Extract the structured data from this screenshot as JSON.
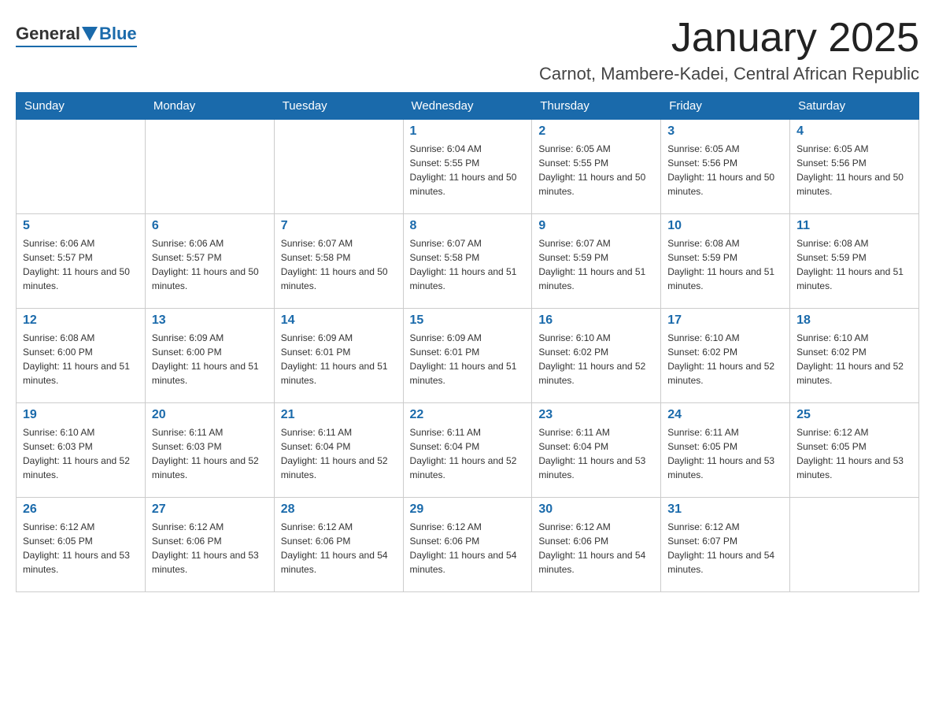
{
  "header": {
    "logo_general": "General",
    "logo_blue": "Blue",
    "title": "January 2025",
    "subtitle": "Carnot, Mambere-Kadei, Central African Republic"
  },
  "days_of_week": [
    "Sunday",
    "Monday",
    "Tuesday",
    "Wednesday",
    "Thursday",
    "Friday",
    "Saturday"
  ],
  "weeks": [
    [
      {
        "day": "",
        "info": ""
      },
      {
        "day": "",
        "info": ""
      },
      {
        "day": "",
        "info": ""
      },
      {
        "day": "1",
        "info": "Sunrise: 6:04 AM\nSunset: 5:55 PM\nDaylight: 11 hours and 50 minutes."
      },
      {
        "day": "2",
        "info": "Sunrise: 6:05 AM\nSunset: 5:55 PM\nDaylight: 11 hours and 50 minutes."
      },
      {
        "day": "3",
        "info": "Sunrise: 6:05 AM\nSunset: 5:56 PM\nDaylight: 11 hours and 50 minutes."
      },
      {
        "day": "4",
        "info": "Sunrise: 6:05 AM\nSunset: 5:56 PM\nDaylight: 11 hours and 50 minutes."
      }
    ],
    [
      {
        "day": "5",
        "info": "Sunrise: 6:06 AM\nSunset: 5:57 PM\nDaylight: 11 hours and 50 minutes."
      },
      {
        "day": "6",
        "info": "Sunrise: 6:06 AM\nSunset: 5:57 PM\nDaylight: 11 hours and 50 minutes."
      },
      {
        "day": "7",
        "info": "Sunrise: 6:07 AM\nSunset: 5:58 PM\nDaylight: 11 hours and 50 minutes."
      },
      {
        "day": "8",
        "info": "Sunrise: 6:07 AM\nSunset: 5:58 PM\nDaylight: 11 hours and 51 minutes."
      },
      {
        "day": "9",
        "info": "Sunrise: 6:07 AM\nSunset: 5:59 PM\nDaylight: 11 hours and 51 minutes."
      },
      {
        "day": "10",
        "info": "Sunrise: 6:08 AM\nSunset: 5:59 PM\nDaylight: 11 hours and 51 minutes."
      },
      {
        "day": "11",
        "info": "Sunrise: 6:08 AM\nSunset: 5:59 PM\nDaylight: 11 hours and 51 minutes."
      }
    ],
    [
      {
        "day": "12",
        "info": "Sunrise: 6:08 AM\nSunset: 6:00 PM\nDaylight: 11 hours and 51 minutes."
      },
      {
        "day": "13",
        "info": "Sunrise: 6:09 AM\nSunset: 6:00 PM\nDaylight: 11 hours and 51 minutes."
      },
      {
        "day": "14",
        "info": "Sunrise: 6:09 AM\nSunset: 6:01 PM\nDaylight: 11 hours and 51 minutes."
      },
      {
        "day": "15",
        "info": "Sunrise: 6:09 AM\nSunset: 6:01 PM\nDaylight: 11 hours and 51 minutes."
      },
      {
        "day": "16",
        "info": "Sunrise: 6:10 AM\nSunset: 6:02 PM\nDaylight: 11 hours and 52 minutes."
      },
      {
        "day": "17",
        "info": "Sunrise: 6:10 AM\nSunset: 6:02 PM\nDaylight: 11 hours and 52 minutes."
      },
      {
        "day": "18",
        "info": "Sunrise: 6:10 AM\nSunset: 6:02 PM\nDaylight: 11 hours and 52 minutes."
      }
    ],
    [
      {
        "day": "19",
        "info": "Sunrise: 6:10 AM\nSunset: 6:03 PM\nDaylight: 11 hours and 52 minutes."
      },
      {
        "day": "20",
        "info": "Sunrise: 6:11 AM\nSunset: 6:03 PM\nDaylight: 11 hours and 52 minutes."
      },
      {
        "day": "21",
        "info": "Sunrise: 6:11 AM\nSunset: 6:04 PM\nDaylight: 11 hours and 52 minutes."
      },
      {
        "day": "22",
        "info": "Sunrise: 6:11 AM\nSunset: 6:04 PM\nDaylight: 11 hours and 52 minutes."
      },
      {
        "day": "23",
        "info": "Sunrise: 6:11 AM\nSunset: 6:04 PM\nDaylight: 11 hours and 53 minutes."
      },
      {
        "day": "24",
        "info": "Sunrise: 6:11 AM\nSunset: 6:05 PM\nDaylight: 11 hours and 53 minutes."
      },
      {
        "day": "25",
        "info": "Sunrise: 6:12 AM\nSunset: 6:05 PM\nDaylight: 11 hours and 53 minutes."
      }
    ],
    [
      {
        "day": "26",
        "info": "Sunrise: 6:12 AM\nSunset: 6:05 PM\nDaylight: 11 hours and 53 minutes."
      },
      {
        "day": "27",
        "info": "Sunrise: 6:12 AM\nSunset: 6:06 PM\nDaylight: 11 hours and 53 minutes."
      },
      {
        "day": "28",
        "info": "Sunrise: 6:12 AM\nSunset: 6:06 PM\nDaylight: 11 hours and 54 minutes."
      },
      {
        "day": "29",
        "info": "Sunrise: 6:12 AM\nSunset: 6:06 PM\nDaylight: 11 hours and 54 minutes."
      },
      {
        "day": "30",
        "info": "Sunrise: 6:12 AM\nSunset: 6:06 PM\nDaylight: 11 hours and 54 minutes."
      },
      {
        "day": "31",
        "info": "Sunrise: 6:12 AM\nSunset: 6:07 PM\nDaylight: 11 hours and 54 minutes."
      },
      {
        "day": "",
        "info": ""
      }
    ]
  ]
}
